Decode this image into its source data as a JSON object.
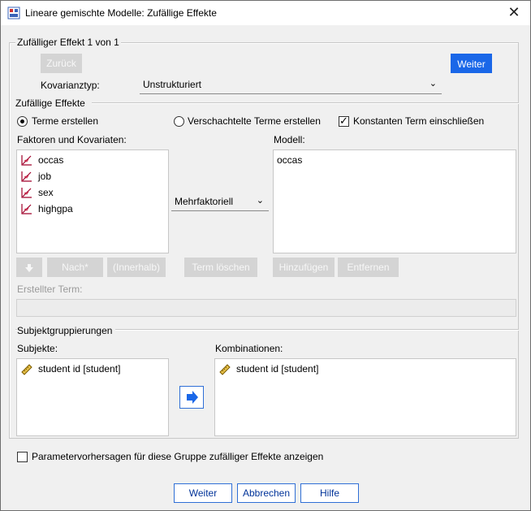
{
  "window": {
    "title": "Lineare gemischte Modelle: Zufällige Effekte"
  },
  "effect_group": {
    "label": "Zufälliger Effekt 1 von 1",
    "back_button": "Zurück",
    "next_button": "Weiter",
    "covariance_label": "Kovarianztyp:",
    "covariance_value": "Unstrukturiert"
  },
  "random_effects": {
    "label": "Zufällige Effekte",
    "radio_build": "Terme erstellen",
    "radio_nested": "Verschachtelte Terme erstellen",
    "checkbox_intercept": "Konstanten Term einschließen",
    "factors_label": "Faktoren und Kovariaten:",
    "factors": [
      "occas",
      "job",
      "sex",
      "highgpa"
    ],
    "model_label": "Modell:",
    "model_items": [
      "occas"
    ],
    "factorial_combo": "Mehrfaktoriell",
    "nach_button": "Nach*",
    "innerhalb_button": "(Innerhalb)",
    "delete_term_button": "Term löschen",
    "add_button": "Hinzufügen",
    "remove_button": "Entfernen",
    "built_term_label": "Erstellter Term:"
  },
  "subject_group": {
    "label": "Subjektgruppierungen",
    "subjects_label": "Subjekte:",
    "subjects": [
      "student id [student]"
    ],
    "combinations_label": "Kombinationen:",
    "combinations": [
      "student id [student]"
    ]
  },
  "predictions_checkbox": "Parametervorhersagen für diese Gruppe zufälliger Effekte anzeigen",
  "footer": {
    "ok": "Weiter",
    "cancel": "Abbrechen",
    "help": "Hilfe"
  },
  "colors": {
    "accent": "#1a67e8",
    "disabled": "#d4d4d4"
  },
  "icons": {
    "scale_variable": "ruler-scale-icon",
    "nominal_variable": "ruler-nominal-icon"
  }
}
